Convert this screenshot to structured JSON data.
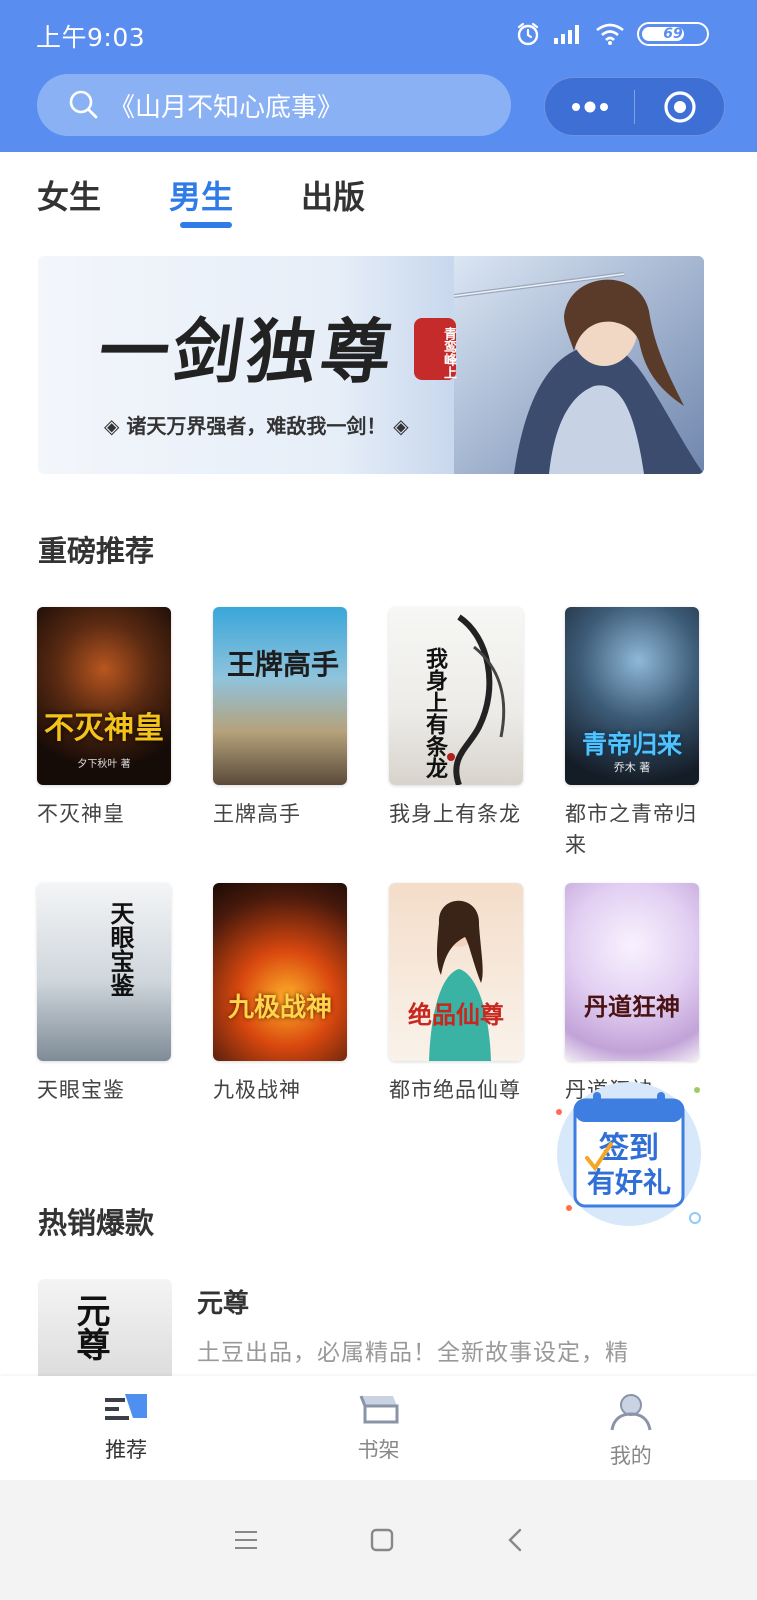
{
  "status_bar": {
    "time": "上午9:03",
    "battery": "69"
  },
  "search": {
    "text": "《山月不知心底事》"
  },
  "tabs": [
    {
      "label": "女生"
    },
    {
      "label": "男生"
    },
    {
      "label": "出版"
    }
  ],
  "banner": {
    "title": "一剑独尊",
    "seal": "青鸾峰上",
    "slogan": "诸天万界强者，难敌我一剑！"
  },
  "section_recommend": {
    "title": "重磅推荐"
  },
  "books": [
    {
      "name": "不灭神皇",
      "cover_text": "不灭神皇",
      "cover_author": "夕下秋叶 著"
    },
    {
      "name": "王牌高手",
      "cover_text": "王牌高手",
      "cover_author": ""
    },
    {
      "name": "我身上有条龙",
      "cover_text": "我身上有条龙",
      "cover_author": ""
    },
    {
      "name": "都市之青帝归来",
      "cover_text": "青帝归来",
      "cover_author": "乔木 著"
    },
    {
      "name": "天眼宝鉴",
      "cover_text": "天眼宝鉴",
      "cover_author": ""
    },
    {
      "name": "九极战神",
      "cover_text": "九极战神",
      "cover_author": ""
    },
    {
      "name": "都市绝品仙尊",
      "cover_text": "绝品仙尊",
      "cover_author": ""
    },
    {
      "name": "丹道狂神",
      "cover_text": "丹道狂神",
      "cover_author": ""
    }
  ],
  "signin_badge": {
    "line1": "签到",
    "line2": "有好礼"
  },
  "section_hot": {
    "title": "热销爆款"
  },
  "hot_items": [
    {
      "title": "元尊",
      "cover_text": "元尊",
      "desc": "土豆出品，必属精品！全新故事设定，精"
    }
  ],
  "tabbar": [
    {
      "label": "推荐",
      "icon": "recommend-icon"
    },
    {
      "label": "书架",
      "icon": "bookshelf-icon"
    },
    {
      "label": "我的",
      "icon": "profile-icon"
    }
  ],
  "colors": {
    "header": "#5a8df0",
    "accent": "#2f7be8"
  }
}
